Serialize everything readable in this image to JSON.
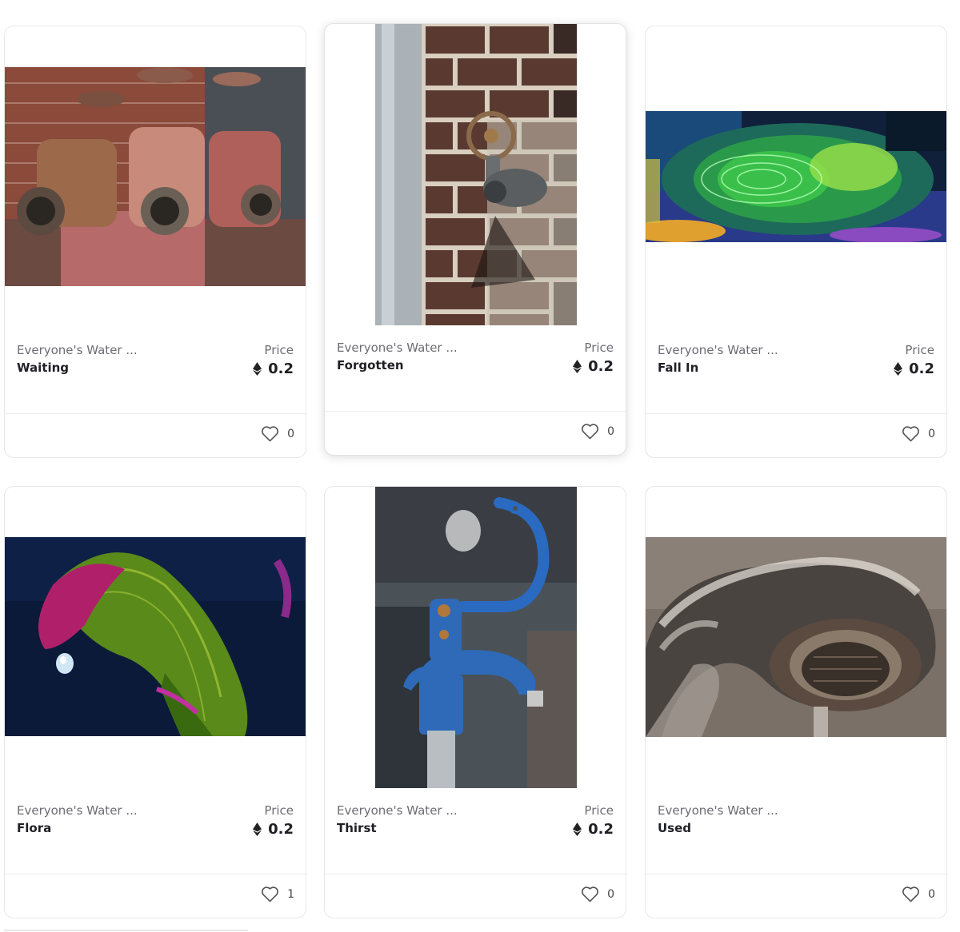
{
  "price_label": "Price",
  "cards": [
    {
      "collection": "Everyone's Water ...",
      "title": "Waiting",
      "price_label": "Price",
      "price": "0.2",
      "likes": "0",
      "image": "rusty fire hose valves"
    },
    {
      "collection": "Everyone's Water ...",
      "title": "Forgotten",
      "price_label": "Price",
      "price": "0.2",
      "likes": "0",
      "image": "old spigot on brick wall"
    },
    {
      "collection": "Everyone's Water ...",
      "title": "Fall In",
      "price_label": "Price",
      "price": "0.2",
      "likes": "0",
      "image": "colorful water ripples"
    },
    {
      "collection": "Everyone's Water ...",
      "title": "Flora",
      "price_label": "Price",
      "price": "0.2",
      "likes": "1",
      "image": "calla lily with water drop"
    },
    {
      "collection": "Everyone's Water ...",
      "title": "Thirst",
      "price_label": "Price",
      "price": "0.2",
      "likes": "0",
      "image": "blue hand water pump"
    },
    {
      "collection": "Everyone's Water ...",
      "title": "Used",
      "likes": "0",
      "image": "chrome faucet close-up"
    }
  ],
  "icons": {
    "currency": "ethereum-icon",
    "like": "heart-outline-icon"
  },
  "colors": {
    "text_dark": "#1f1f26",
    "text_muted": "#6c6c75",
    "border": "#e7e7e9"
  }
}
